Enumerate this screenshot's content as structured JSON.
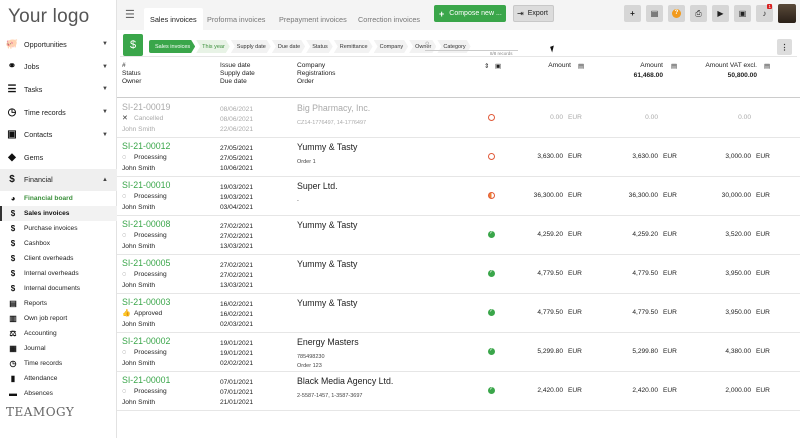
{
  "sidebar": {
    "logo": "Your logo",
    "footer_logo": "TEAMOGY",
    "items": [
      {
        "label": "Opportunities",
        "icon": "piggy-bank-icon",
        "glyph": "🐖",
        "caret": true
      },
      {
        "label": "Jobs",
        "icon": "link-icon",
        "glyph": "⚭",
        "caret": true
      },
      {
        "label": "Tasks",
        "icon": "tasks-icon",
        "glyph": "☰",
        "caret": true
      },
      {
        "label": "Time records",
        "icon": "clock-icon",
        "glyph": "◷",
        "caret": true
      },
      {
        "label": "Contacts",
        "icon": "contacts-icon",
        "glyph": "▣",
        "caret": true
      },
      {
        "label": "Gems",
        "icon": "gem-icon",
        "glyph": "◆",
        "caret": false
      },
      {
        "label": "Financial",
        "icon": "dollar-icon",
        "glyph": "$",
        "caret": true
      }
    ],
    "financial_sub": [
      {
        "label": "Financial board",
        "glyph": "◕",
        "icon": "gauge-icon"
      },
      {
        "label": "Sales invoices",
        "glyph": "$",
        "icon": "dollar-icon"
      },
      {
        "label": "Purchase invoices",
        "glyph": "$",
        "icon": "dollar-icon"
      },
      {
        "label": "Cashbox",
        "glyph": "$",
        "icon": "dollar-icon"
      },
      {
        "label": "Client overheads",
        "glyph": "$",
        "icon": "dollar-icon"
      },
      {
        "label": "Internal overheads",
        "glyph": "$",
        "icon": "dollar-icon"
      },
      {
        "label": "Internal documents",
        "glyph": "$",
        "icon": "dollar-icon"
      },
      {
        "label": "Reports",
        "glyph": "▤",
        "icon": "report-icon"
      },
      {
        "label": "Own job report",
        "glyph": "▥",
        "icon": "chart-icon"
      },
      {
        "label": "Accounting",
        "glyph": "⚖",
        "icon": "scale-icon"
      },
      {
        "label": "Journal",
        "glyph": "▦",
        "icon": "journal-icon"
      },
      {
        "label": "Time records",
        "glyph": "◷",
        "icon": "clock-icon"
      },
      {
        "label": "Attendance",
        "glyph": "▮",
        "icon": "attendance-icon"
      },
      {
        "label": "Absences",
        "glyph": "▬",
        "icon": "absences-icon"
      }
    ]
  },
  "topbar": {
    "tabs": [
      "Sales invoices",
      "Proforma invoices",
      "Prepayment invoices",
      "Correction invoices"
    ],
    "compose_label": "Compose new ...",
    "export_label": "Export",
    "notif_count": "1"
  },
  "filters": {
    "chips": [
      "Sales invoices",
      "This year",
      "Supply date",
      "Due date",
      "Status",
      "Remittance",
      "Company",
      "Owner",
      "Category"
    ],
    "search_placeholder": "",
    "results": "8/8 records"
  },
  "table": {
    "headers": {
      "col1": [
        "#",
        "Status",
        "Owner"
      ],
      "col2": [
        "Issue date",
        "Supply date",
        "Due date"
      ],
      "col3": [
        "Company",
        "Registrations",
        "Order"
      ],
      "amount": "Amount",
      "amount2": "Amount",
      "amount2_total": "61,468.00",
      "vat": "Amount VAT excl.",
      "vat_total": "50,800.00"
    },
    "rows": [
      {
        "num": "SI-21-00019",
        "status": "Cancelled",
        "status_icon": "cancelled-icon",
        "glyph": "✕",
        "owner": "John Smith",
        "issue": "08/06/2021",
        "supply": "08/06/2021",
        "due": "22/06/2021",
        "company": "Big Pharmacy, Inc.",
        "reg": "CZ14-1776497, 14-1776497",
        "indicator": "ring",
        "amount": "0.00",
        "amount2": "0.00",
        "vat": "0.00",
        "cur1": "EUR",
        "cur2": "",
        "cur3": "",
        "grey": true
      },
      {
        "num": "SI-21-00012",
        "status": "Processing",
        "status_icon": "processing-icon",
        "glyph": "◌",
        "owner": "John Smith",
        "issue": "27/05/2021",
        "supply": "27/05/2021",
        "due": "10/06/2021",
        "company": "Yummy & Tasty",
        "reg": "Order 1",
        "indicator": "ring",
        "amount": "3,630.00",
        "amount2": "3,630.00",
        "vat": "3,000.00",
        "cur1": "EUR",
        "cur2": "EUR",
        "cur3": "EUR",
        "grey": false
      },
      {
        "num": "SI-21-00010",
        "status": "Processing",
        "status_icon": "processing-icon",
        "glyph": "◌",
        "owner": "John Smith",
        "issue": "19/03/2021",
        "supply": "19/03/2021",
        "due": "03/04/2021",
        "company": "Super Ltd.",
        "reg": "-",
        "indicator": "half",
        "amount": "36,300.00",
        "amount2": "36,300.00",
        "vat": "30,000.00",
        "cur1": "EUR",
        "cur2": "EUR",
        "cur3": "EUR",
        "grey": false
      },
      {
        "num": "SI-21-00008",
        "status": "Processing",
        "status_icon": "processing-icon",
        "glyph": "◌",
        "owner": "John Smith",
        "issue": "27/02/2021",
        "supply": "27/02/2021",
        "due": "13/03/2021",
        "company": "Yummy & Tasty",
        "reg": "",
        "indicator": "ok",
        "amount": "4,259.20",
        "amount2": "4,259.20",
        "vat": "3,520.00",
        "cur1": "EUR",
        "cur2": "EUR",
        "cur3": "EUR",
        "grey": false
      },
      {
        "num": "SI-21-00005",
        "status": "Processing",
        "status_icon": "processing-icon",
        "glyph": "◌",
        "owner": "John Smith",
        "issue": "27/02/2021",
        "supply": "27/02/2021",
        "due": "13/03/2021",
        "company": "Yummy & Tasty",
        "reg": "",
        "indicator": "ok",
        "amount": "4,779.50",
        "amount2": "4,779.50",
        "vat": "3,950.00",
        "cur1": "EUR",
        "cur2": "EUR",
        "cur3": "EUR",
        "grey": false
      },
      {
        "num": "SI-21-00003",
        "status": "Approved",
        "status_icon": "thumbs-up-icon",
        "glyph": "👍",
        "owner": "John Smith",
        "issue": "16/02/2021",
        "supply": "16/02/2021",
        "due": "02/03/2021",
        "company": "Yummy & Tasty",
        "reg": "",
        "indicator": "ok",
        "amount": "4,779.50",
        "amount2": "4,779.50",
        "vat": "3,950.00",
        "cur1": "EUR",
        "cur2": "EUR",
        "cur3": "EUR",
        "grey": false
      },
      {
        "num": "SI-21-00002",
        "status": "Processing",
        "status_icon": "processing-icon",
        "glyph": "◌",
        "owner": "John Smith",
        "issue": "19/01/2021",
        "supply": "19/01/2021",
        "due": "02/02/2021",
        "company": "Energy Masters",
        "reg": "785498230",
        "order": "Order 123",
        "indicator": "ok",
        "amount": "5,299.80",
        "amount2": "5,299.80",
        "vat": "4,380.00",
        "cur1": "EUR",
        "cur2": "EUR",
        "cur3": "EUR",
        "grey": false
      },
      {
        "num": "SI-21-00001",
        "status": "Processing",
        "status_icon": "processing-icon",
        "glyph": "◌",
        "owner": "John Smith",
        "issue": "07/01/2021",
        "supply": "07/01/2021",
        "due": "21/01/2021",
        "company": "Black Media Agency Ltd.",
        "reg": "2-5587-1457, 1-3587-3697",
        "indicator": "ok",
        "amount": "2,420.00",
        "amount2": "2,420.00",
        "vat": "2,000.00",
        "cur1": "EUR",
        "cur2": "EUR",
        "cur3": "EUR",
        "grey": false
      }
    ]
  }
}
